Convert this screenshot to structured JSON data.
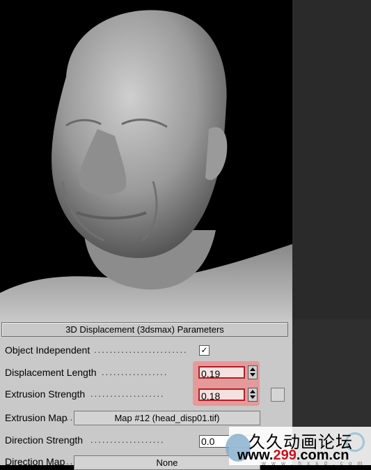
{
  "rollout": {
    "title": "3D Displacement (3dsmax) Parameters"
  },
  "params": {
    "object_independent": {
      "label": "Object Independent",
      "checked": "✓"
    },
    "displacement_length": {
      "label": "Displacement Length",
      "value": "0.19"
    },
    "extrusion_strength": {
      "label": "Extrusion Strength",
      "value": "0.18"
    },
    "extrusion_map": {
      "label": "Extrusion Map",
      "button": "Map #12 (head_disp01.tif)"
    },
    "direction_strength": {
      "label": "Direction Strength",
      "value": "0.0"
    },
    "direction_map": {
      "label": "Direction Map",
      "button": "None"
    }
  },
  "dots": {
    "object_independent": "........................",
    "displacement_length": ".................",
    "extrusion_strength": "...................",
    "extrusion_map": "..",
    "direction_strength": "...................",
    "direction_map": ".."
  },
  "watermark": {
    "chinese": "久久动画论坛",
    "url_prefix": "www.",
    "url_red": "299",
    "url_suffix": ".com.cn",
    "sub": "w w w . h x s d . c o m"
  },
  "colors": {
    "highlight": "#e49a9a",
    "input_border": "#b02020",
    "panel": "#c9c9c9"
  }
}
